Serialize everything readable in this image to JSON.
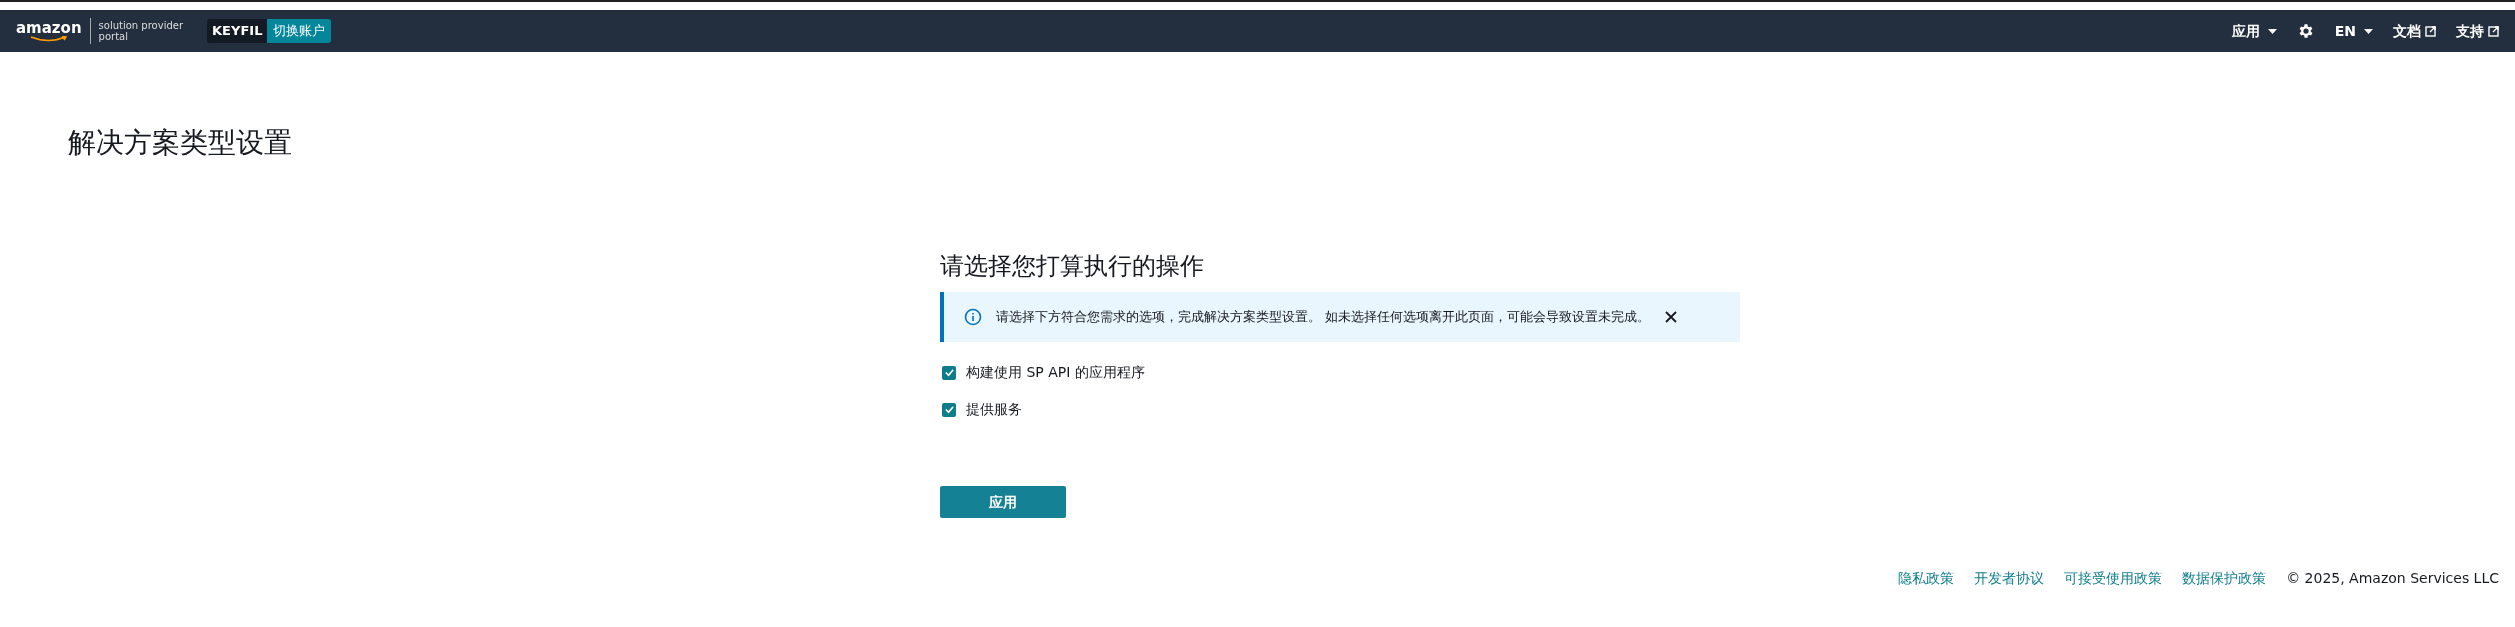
{
  "header": {
    "logo": {
      "brand": "amazon",
      "line_1": "solution provider",
      "line_2": "portal"
    },
    "account": "KEYFIL",
    "switch_account": "切换账户",
    "menus": [
      {
        "kind": "dropdown",
        "label": "应用"
      },
      {
        "kind": "settings"
      },
      {
        "kind": "dropdown",
        "label": "EN"
      },
      {
        "kind": "external",
        "label": "文档"
      },
      {
        "kind": "external",
        "label": "支持"
      }
    ]
  },
  "page_title": "解决方案类型设置",
  "form": {
    "heading": "请选择您打算执行的操作",
    "alert": {
      "text": "请选择下方符合您需求的选项，完成解决方案类型设置。 如未选择任何选项离开此页面，可能会导致设置未完成。",
      "dismissible": true
    },
    "options": [
      {
        "label": "构建使用 SP API 的应用程序",
        "checked": true
      },
      {
        "label": "提供服务",
        "checked": true
      }
    ],
    "submit": "应用"
  },
  "footer": {
    "links": [
      "隐私政策",
      "开发者协议",
      "可接受使用政策",
      "数据保护政策"
    ],
    "copyright": "© 2025, Amazon Services LLC"
  }
}
